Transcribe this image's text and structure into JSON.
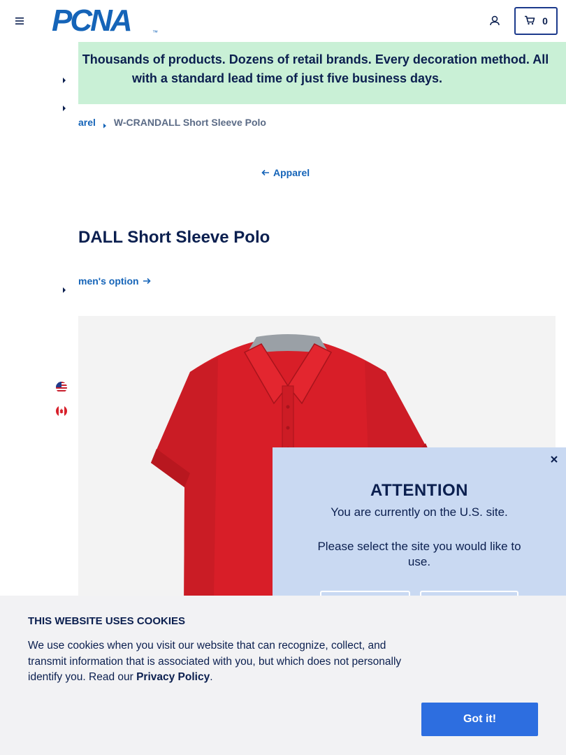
{
  "header": {
    "logo_text": "PCNA",
    "logo_tm": "™",
    "cart_count": "0"
  },
  "banner": {
    "line1": "! Thousands of products. Dozens of retail brands. Every decoration method. All",
    "line2": "with a standard lead time of just five business days."
  },
  "breadcrumb": {
    "parent": "arel",
    "current": "W-CRANDALL Short Sleeve Polo"
  },
  "back_link": "Apparel",
  "product": {
    "title": "DALL Short Sleeve Polo",
    "option_link": "men's option"
  },
  "modal": {
    "title": "ATTENTION",
    "line1": "You are currently on the U.S. site.",
    "line2": "Please select the site you would like to use."
  },
  "cookie": {
    "title": "THIS WEBSITE USES COOKIES",
    "body": "We use cookies when you visit our website that can recognize, collect, and transmit information that is associated with you, but which does not personally identify you. Read our ",
    "privacy_link": "Privacy Policy",
    "period": ".",
    "button": "Got it!"
  },
  "colors": {
    "brand_blue": "#1564b8",
    "banner_green": "#c9f0d6",
    "modal_blue": "#c9d9f2",
    "button_blue": "#2d6ee0",
    "polo_red": "#d81e28"
  },
  "icons": [
    "hamburger-menu-icon",
    "user-icon",
    "cart-icon",
    "caret-right-icon",
    "arrow-left-icon",
    "arrow-right-icon",
    "us-flag-icon",
    "canada-flag-icon",
    "close-icon"
  ]
}
